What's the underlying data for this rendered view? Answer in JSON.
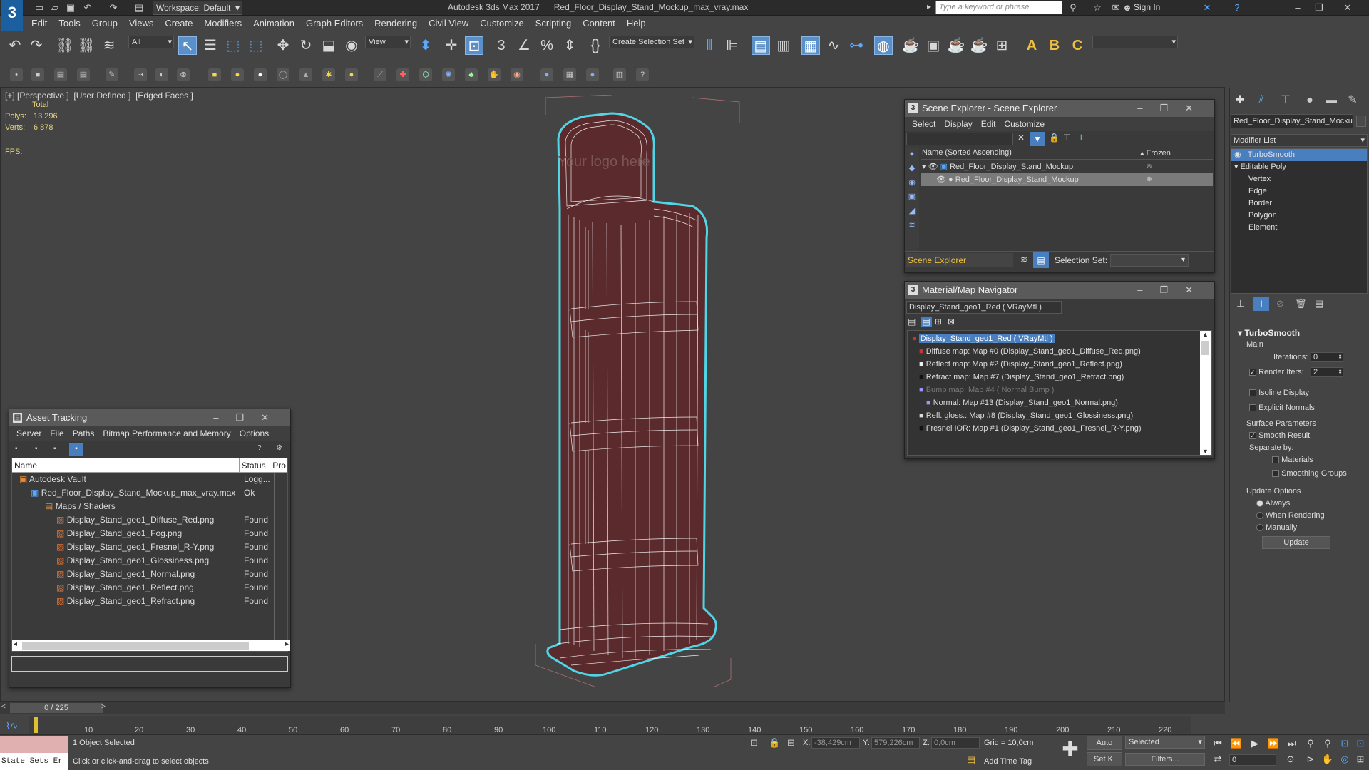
{
  "titlebar": {
    "workspace": "Workspace: Default",
    "title": "Autodesk 3ds Max 2017      Red_Floor_Display_Stand_Mockup_max_vray.max",
    "search_placeholder": "Type a keyword or phrase",
    "sign_in": "Sign In"
  },
  "menu": [
    "Edit",
    "Tools",
    "Group",
    "Views",
    "Create",
    "Modifiers",
    "Animation",
    "Graph Editors",
    "Rendering",
    "Civil View",
    "Customize",
    "Scripting",
    "Content",
    "Help"
  ],
  "toolbar": {
    "filter": "All",
    "refcoord": "View",
    "selection_set": "Create Selection Set"
  },
  "viewport": {
    "label": "[+] [Perspective ]  [User Defined ]  [Edged Faces ]",
    "total_label": "Total",
    "polys_label": "Polys:",
    "polys_value": "13 296",
    "verts_label": "Verts:",
    "verts_value": "6 878",
    "fps_label": "FPS:",
    "logo_text": "Your logo here"
  },
  "asset_tracking": {
    "title": "Asset Tracking",
    "menu": [
      "Server",
      "File",
      "Paths",
      "Bitmap Performance and Memory",
      "Options"
    ],
    "columns": [
      "Name",
      "Status",
      "Pro"
    ],
    "rows": [
      {
        "name": "Autodesk Vault",
        "status": "Logg..."
      },
      {
        "name": "Red_Floor_Display_Stand_Mockup_max_vray.max",
        "status": "Ok"
      },
      {
        "name": "Maps / Shaders",
        "status": ""
      },
      {
        "name": "Display_Stand_geo1_Diffuse_Red.png",
        "status": "Found"
      },
      {
        "name": "Display_Stand_geo1_Fog.png",
        "status": "Found"
      },
      {
        "name": "Display_Stand_geo1_Fresnel_R-Y.png",
        "status": "Found"
      },
      {
        "name": "Display_Stand_geo1_Glossiness.png",
        "status": "Found"
      },
      {
        "name": "Display_Stand_geo1_Normal.png",
        "status": "Found"
      },
      {
        "name": "Display_Stand_geo1_Reflect.png",
        "status": "Found"
      },
      {
        "name": "Display_Stand_geo1_Refract.png",
        "status": "Found"
      }
    ]
  },
  "scene_explorer": {
    "title": "Scene Explorer - Scene Explorer",
    "menu": [
      "Select",
      "Display",
      "Edit",
      "Customize"
    ],
    "col_name": "Name (Sorted Ascending)",
    "col_frozen": "▴ Frozen",
    "rows": [
      "Red_Floor_Display_Stand_Mockup",
      "Red_Floor_Display_Stand_Mockup"
    ],
    "footer_name": "Scene Explorer",
    "selection_set_label": "Selection Set:"
  },
  "material_navigator": {
    "title": "Material/Map Navigator",
    "field": "Display_Stand_geo1_Red  ( VRayMtl )",
    "rows": [
      "Display_Stand_geo1_Red  ( VRayMtl )",
      "Diffuse map: Map #0 (Display_Stand_geo1_Diffuse_Red.png)",
      "Reflect map: Map #2 (Display_Stand_geo1_Reflect.png)",
      "Refract map: Map #7 (Display_Stand_geo1_Refract.png)",
      "Bump map: Map #4  ( Normal Bump )",
      "Normal: Map #13 (Display_Stand_geo1_Normal.png)",
      "Refl. gloss.: Map #8 (Display_Stand_geo1_Glossiness.png)",
      "Fresnel IOR: Map #1 (Display_Stand_geo1_Fresnel_R-Y.png)"
    ]
  },
  "command_panel": {
    "object_name": "Red_Floor_Display_Stand_Mockup",
    "modifier_list": "Modifier List",
    "stack": [
      "TurboSmooth",
      "Editable Poly",
      "Vertex",
      "Edge",
      "Border",
      "Polygon",
      "Element"
    ],
    "rollout_title": "TurboSmooth",
    "main_label": "Main",
    "iterations_label": "Iterations:",
    "iterations_value": "0",
    "render_iters_label": "Render Iters:",
    "render_iters_value": "2",
    "isoline": "Isoline Display",
    "explicit_normals": "Explicit Normals",
    "surface_params": "Surface Parameters",
    "smooth_result": "Smooth Result",
    "separate_by": "Separate by:",
    "materials": "Materials",
    "smoothing_groups": "Smoothing Groups",
    "update_options": "Update Options",
    "always": "Always",
    "when_rendering": "When Rendering",
    "manually": "Manually",
    "update_button": "Update"
  },
  "timeline": {
    "frame": "0 / 225",
    "ticks": [
      "10",
      "20",
      "30",
      "40",
      "50",
      "60",
      "70",
      "80",
      "90",
      "100",
      "110",
      "120",
      "130",
      "140",
      "150",
      "160",
      "170",
      "180",
      "190",
      "200",
      "210",
      "220"
    ]
  },
  "status": {
    "state_sets": "State Sets Er",
    "selected": "1 Object Selected",
    "prompt": "Click or click-and-drag to select objects",
    "x_label": "X:",
    "x_value": "-38,429cm",
    "y_label": "Y:",
    "y_value": "579,226cm",
    "z_label": "Z:",
    "z_value": "0,0cm",
    "grid": "Grid = 10,0cm",
    "add_time_tag": "Add Time Tag",
    "auto": "Auto",
    "set_key": "Set K.",
    "selected_dd": "Selected",
    "filters": "Filters...",
    "frame_field": "0"
  },
  "colors": {
    "accent": "#4a7fbf",
    "selection_outline": "#4fd6e6",
    "stand_fill": "#5a2a2c",
    "wire": "#ffffff"
  }
}
